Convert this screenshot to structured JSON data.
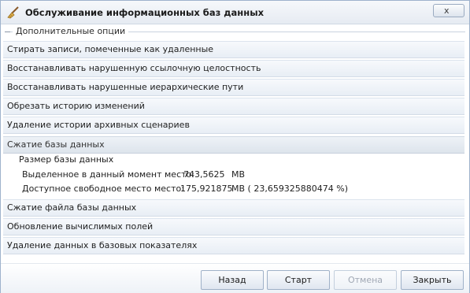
{
  "window": {
    "title": "Обслуживание информационных баз данных",
    "close_label": "x"
  },
  "group": {
    "label": "Дополнительные опции"
  },
  "sections": [
    {
      "label": "Стирать записи, помеченные как удаленные"
    },
    {
      "label": "Восстанавливать нарушенную ссылочную целостность"
    },
    {
      "label": "Восстанавливать нарушенные иерархические пути"
    },
    {
      "label": "Обрезать историю изменений"
    },
    {
      "label": "Удаление истории архивных сценариев"
    },
    {
      "label": "Сжатие базы данных"
    },
    {
      "label": "Сжатие файла базы данных"
    },
    {
      "label": "Обновление вычислимых полей"
    },
    {
      "label": "Удаление данных в базовых показателях"
    }
  ],
  "db_size": {
    "heading": "Размер базы данных",
    "allocated_label": "Выделенное в данный момент место:",
    "allocated_value": "743,5625",
    "allocated_unit": "MB",
    "free_label": "Доступное свободное место место:",
    "free_value": "175,921875",
    "free_unit": "MB ( 23,659325880474 %)"
  },
  "buttons": {
    "back": "Назад",
    "start": "Старт",
    "cancel": "Отмена",
    "close": "Закрыть"
  }
}
